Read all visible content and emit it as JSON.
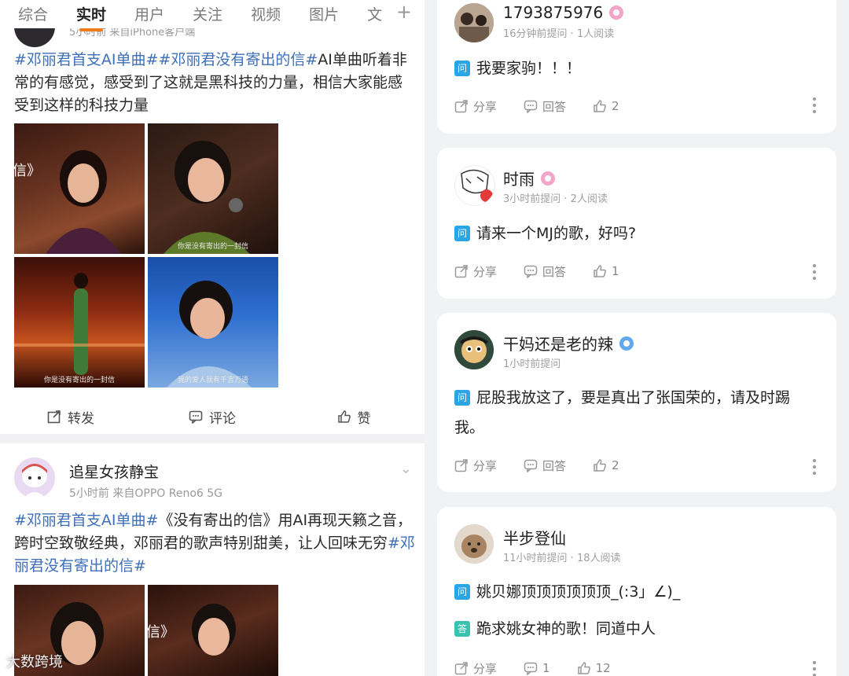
{
  "tabs": [
    "综合",
    "实时",
    "用户",
    "关注",
    "视频",
    "图片",
    "文"
  ],
  "active_tab_index": 1,
  "post1": {
    "meta_partial": "5小时前  来自iPhone客户端",
    "text_prefix_tags": "#邓丽君首支AI单曲##邓丽君没有寄出的信#",
    "text_rest": "AI单曲听着非常的有感觉，感受到了这就是黑科技的力量，相信大家能感受到这样的科技力量",
    "image_captions": [
      "",
      "你是没有寄出的一封信",
      "你是没有寄出的一封信",
      "我的爱人我有千言万语"
    ],
    "actions": {
      "repost": "转发",
      "comment": "评论",
      "like": "赞"
    }
  },
  "post2": {
    "name": "追星女孩静宝",
    "meta": "5小时前  来自OPPO Reno6 5G",
    "tag1": "#邓丽君首支AI单曲#",
    "text1": "《没有寄出的信》用AI再现天籁之音，跨时空致敬经典，邓丽君的歌声特别甜美，让人回味无穷",
    "tag2": "#邓丽君没有寄出的信#"
  },
  "watermark": "大数跨境",
  "qa": [
    {
      "name": "1793875976",
      "meta": "16分钟前提问 · 1人阅读",
      "badge": "pink",
      "question": "我要家驹！！！",
      "answer": "",
      "share": "分享",
      "reply": "回答",
      "likes": "2",
      "reply_count": ""
    },
    {
      "name": "时雨",
      "meta": "3小时前提问 · 2人阅读",
      "badge": "pink",
      "question": "请来一个MJ的歌，好吗?",
      "answer": "",
      "share": "分享",
      "reply": "回答",
      "likes": "1",
      "reply_count": ""
    },
    {
      "name": "干妈还是老的辣",
      "meta": "1小时前提问",
      "badge": "blue",
      "question": "屁股我放这了，要是真出了张国荣的，请及时踢我。",
      "answer": "",
      "share": "分享",
      "reply": "回答",
      "likes": "2",
      "reply_count": ""
    },
    {
      "name": "半步登仙",
      "meta": "11小时前提问 · 18人阅读",
      "badge": "",
      "question": "姚贝娜顶顶顶顶顶顶_(:3」∠)_",
      "answer": "跪求姚女神的歌！同道中人",
      "share": "分享",
      "reply": "",
      "likes": "12",
      "reply_count": "1"
    }
  ],
  "labels": {
    "q": "问",
    "a": "答"
  },
  "colors": {
    "accent": "#f07b1b",
    "link": "#3e6fb8",
    "question_icon": "#2ba5e6",
    "answer_icon": "#38c2b0"
  }
}
